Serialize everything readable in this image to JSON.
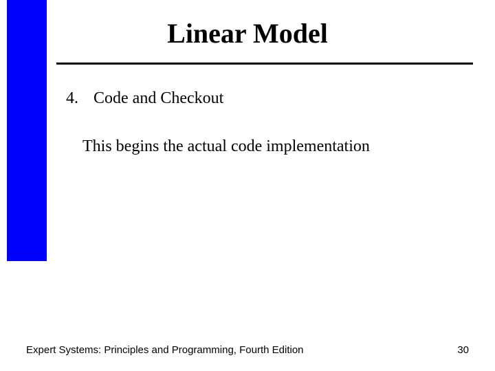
{
  "title": "Linear Model",
  "list": {
    "number": "4.",
    "label": "Code and Checkout"
  },
  "description": "This begins the actual code implementation",
  "footer": {
    "left": "Expert Systems: Principles and Programming, Fourth Edition",
    "page": "30"
  }
}
